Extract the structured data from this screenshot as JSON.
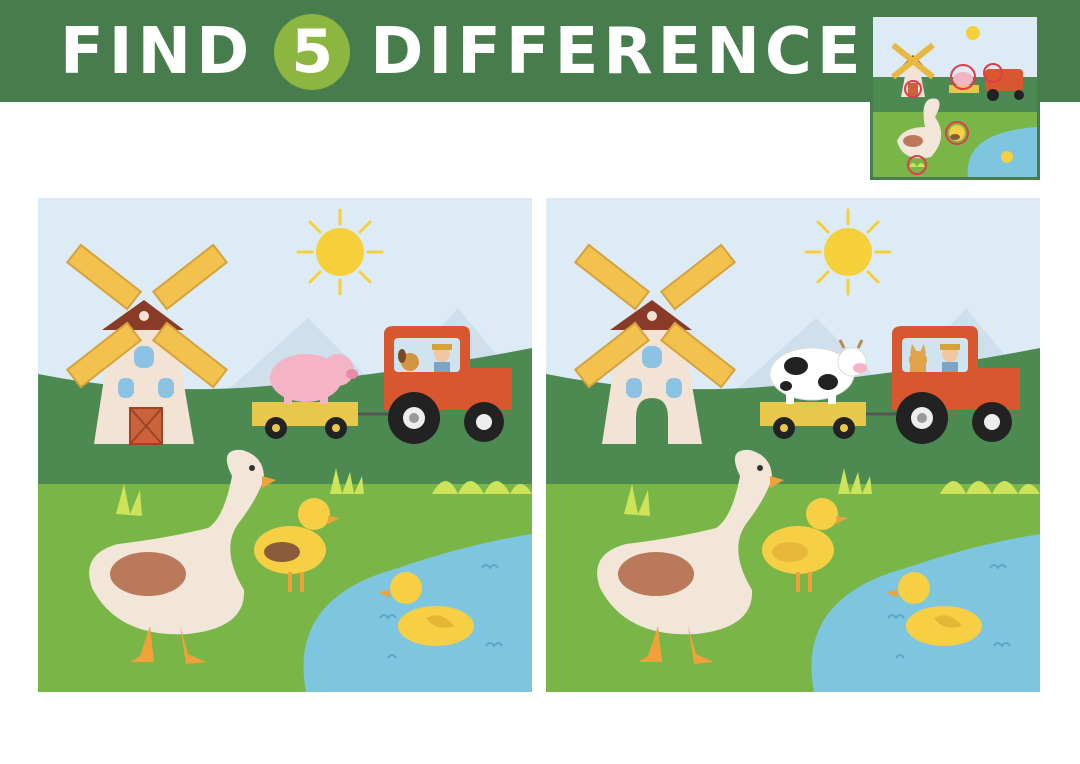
{
  "header": {
    "word1": "FIND",
    "number": "5",
    "word2": "DIFFERENCES"
  },
  "colors": {
    "banner": "#477c4c",
    "badge": "#8cb640",
    "sky": "#dcebf5",
    "hill": "#4d8a52",
    "grass": "#7ab548",
    "pond": "#7ec6df",
    "sun": "#f6d03b",
    "tractor": "#d8572e",
    "pig": "#f5b3c6",
    "duck": "#f7cf45",
    "goose": "#f1e6d8",
    "circle": "#e03b4d"
  },
  "panels": [
    {
      "id": "left",
      "trailer_animal": "pig",
      "passenger": "dog",
      "door": "barn-door",
      "duckling_wing": "brown",
      "grass_tuft": true
    },
    {
      "id": "right",
      "trailer_animal": "cow",
      "passenger": "cat",
      "door": "arch-door",
      "duckling_wing": "yellow",
      "grass_tuft": true
    }
  ],
  "answer_key": {
    "circles": 5
  }
}
